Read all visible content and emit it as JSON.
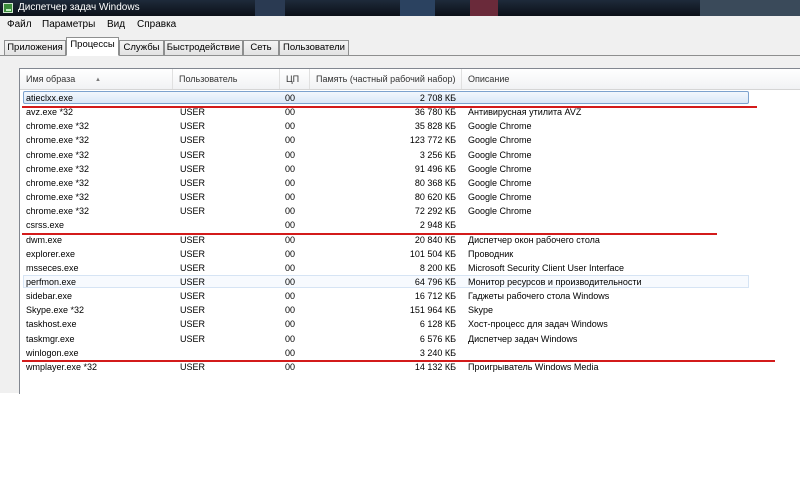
{
  "window": {
    "title": "Диспетчер задач Windows"
  },
  "menu": [
    "Файл",
    "Параметры",
    "Вид",
    "Справка"
  ],
  "tabs": [
    "Приложения",
    "Процессы",
    "Службы",
    "Быстродействие",
    "Сеть",
    "Пользователи"
  ],
  "active_tab": "Процессы",
  "columns": {
    "name": "Имя образа",
    "user": "Пользователь",
    "cpu": "ЦП",
    "memory": "Память (частный рабочий набор)",
    "description": "Описание"
  },
  "processes": [
    {
      "name": "atieclxx.exe",
      "user": "",
      "cpu": "00",
      "memory": "2 708 КБ",
      "description": ""
    },
    {
      "name": "avz.exe *32",
      "user": "USER",
      "cpu": "00",
      "memory": "36 780 КБ",
      "description": "Антивирусная утилита AVZ"
    },
    {
      "name": "chrome.exe *32",
      "user": "USER",
      "cpu": "00",
      "memory": "35 828 КБ",
      "description": "Google Chrome"
    },
    {
      "name": "chrome.exe *32",
      "user": "USER",
      "cpu": "00",
      "memory": "123 772 КБ",
      "description": "Google Chrome"
    },
    {
      "name": "chrome.exe *32",
      "user": "USER",
      "cpu": "00",
      "memory": "3 256 КБ",
      "description": "Google Chrome"
    },
    {
      "name": "chrome.exe *32",
      "user": "USER",
      "cpu": "00",
      "memory": "91 496 КБ",
      "description": "Google Chrome"
    },
    {
      "name": "chrome.exe *32",
      "user": "USER",
      "cpu": "00",
      "memory": "80 368 КБ",
      "description": "Google Chrome"
    },
    {
      "name": "chrome.exe *32",
      "user": "USER",
      "cpu": "00",
      "memory": "80 620 КБ",
      "description": "Google Chrome"
    },
    {
      "name": "chrome.exe *32",
      "user": "USER",
      "cpu": "00",
      "memory": "72 292 КБ",
      "description": "Google Chrome"
    },
    {
      "name": "csrss.exe",
      "user": "",
      "cpu": "00",
      "memory": "2 948 КБ",
      "description": ""
    },
    {
      "name": "dwm.exe",
      "user": "USER",
      "cpu": "00",
      "memory": "20 840 КБ",
      "description": "Диспетчер окон рабочего стола"
    },
    {
      "name": "explorer.exe",
      "user": "USER",
      "cpu": "00",
      "memory": "101 504 КБ",
      "description": "Проводник"
    },
    {
      "name": "msseces.exe",
      "user": "USER",
      "cpu": "00",
      "memory": "8 200 КБ",
      "description": "Microsoft Security Client User Interface"
    },
    {
      "name": "perfmon.exe",
      "user": "USER",
      "cpu": "00",
      "memory": "64 796 КБ",
      "description": "Монитор ресурсов и производительности"
    },
    {
      "name": "sidebar.exe",
      "user": "USER",
      "cpu": "00",
      "memory": "16 712 КБ",
      "description": "Гаджеты рабочего стола Windows"
    },
    {
      "name": "Skype.exe *32",
      "user": "USER",
      "cpu": "00",
      "memory": "151 964 КБ",
      "description": "Skype"
    },
    {
      "name": "taskhost.exe",
      "user": "USER",
      "cpu": "00",
      "memory": "6 128 КБ",
      "description": "Хост-процесс для задач Windows"
    },
    {
      "name": "taskmgr.exe",
      "user": "USER",
      "cpu": "00",
      "memory": "6 576 КБ",
      "description": "Диспетчер задач Windows"
    },
    {
      "name": "winlogon.exe",
      "user": "",
      "cpu": "00",
      "memory": "3 240 КБ",
      "description": ""
    },
    {
      "name": "wmplayer.exe *32",
      "user": "USER",
      "cpu": "00",
      "memory": "14 132 КБ",
      "description": "Проигрыватель Windows Media"
    }
  ],
  "selected_process": "atieclxx.exe",
  "hovered_process": "perfmon.exe",
  "highlight_color": "#d31b1b"
}
